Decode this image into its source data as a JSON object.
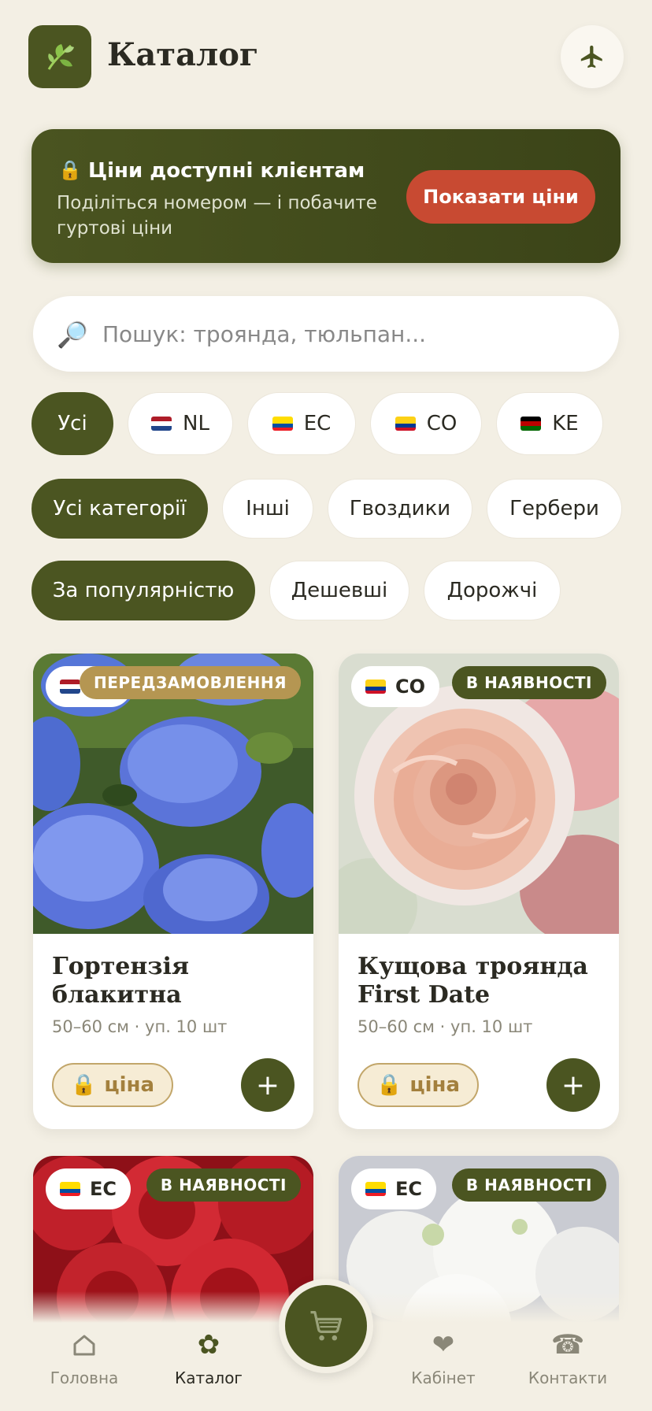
{
  "header": {
    "title": "Каталог",
    "logo_icon": "leaf-icon",
    "action_icon": "plane-icon"
  },
  "banner": {
    "lock_icon": "🔒",
    "title": "Ціни доступні клієнтам",
    "subtitle": "Поділіться номером — і побачите гуртові ціни",
    "button_label": "Показати ціни"
  },
  "search": {
    "icon": "🔎",
    "placeholder": "Пошук: троянда, тюльпан..."
  },
  "origin_filters": [
    {
      "label": "Усі",
      "active": true
    },
    {
      "label": "NL",
      "flag": [
        "#ae1c28",
        "#ffffff",
        "#21468b"
      ]
    },
    {
      "label": "EC",
      "flag": [
        "#ffdd00",
        "#034ea2",
        "#ed1c24"
      ]
    },
    {
      "label": "CO",
      "flag": [
        "#fcd116",
        "#003893",
        "#ce1126"
      ]
    },
    {
      "label": "KE",
      "flag": [
        "#000000",
        "#bb0000",
        "#006600"
      ]
    }
  ],
  "category_filters": [
    "Усі категорії",
    "Інші",
    "Гвоздики",
    "Гербери"
  ],
  "sort_options": [
    "За популярністю",
    "Дешевші",
    "Дорожчі"
  ],
  "products": [
    {
      "origin": "NL",
      "status": "ПЕРЕДЗАМОВЛЕННЯ",
      "name": "Гортензія блакитна",
      "meta": "50–60 см · уп. 10 шт",
      "price_label": "ціна"
    },
    {
      "origin": "CO",
      "status": "В НАЯВНОСТІ",
      "name": "Кущова троянда First Date",
      "meta": "50–60 см · уп. 10 шт",
      "price_label": "ціна"
    },
    {
      "origin": "EC",
      "status": "В НАЯВНОСТІ"
    },
    {
      "origin": "EC",
      "status": "В НАЯВНОСТІ"
    }
  ],
  "nav": {
    "home": "Головна",
    "catalog": "Каталог",
    "cabinet": "Кабінет",
    "contacts": "Контакти"
  },
  "colors": {
    "accent": "#4b5521",
    "cta": "#c84a32",
    "background": "#f3efe4",
    "preorder": "#b59652"
  }
}
